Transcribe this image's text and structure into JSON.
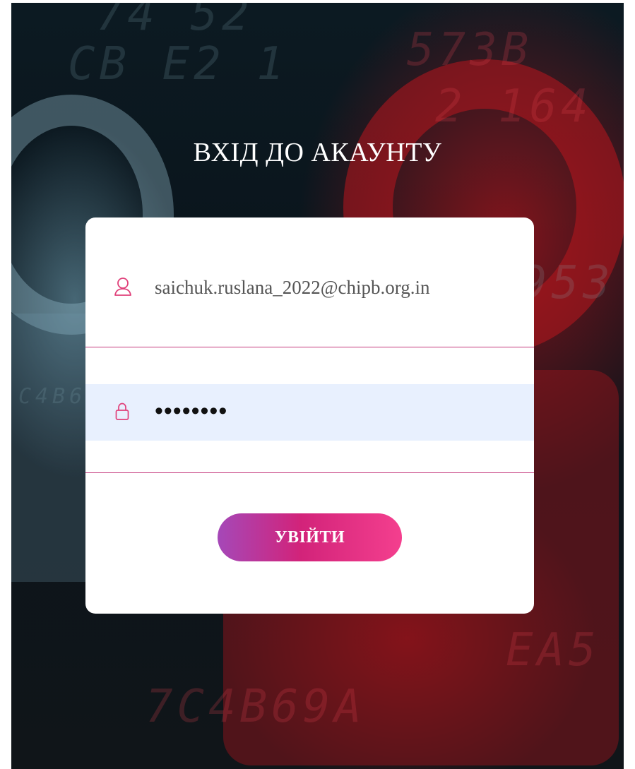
{
  "login": {
    "title": "ВХІД ДО АКАУНТУ",
    "email_value": "saichuk.ruslana_2022@chipb.org.in",
    "password_value": "••••••••",
    "submit_label": "УВІЙТИ"
  },
  "icons": {
    "email_field_icon": "user-icon",
    "password_field_icon": "lock-icon"
  },
  "colors": {
    "accent": "#e0407a",
    "button_gradient_start": "#a548b8",
    "button_gradient_end": "#f43f8e",
    "autofill_bg": "#e8f0fe"
  }
}
